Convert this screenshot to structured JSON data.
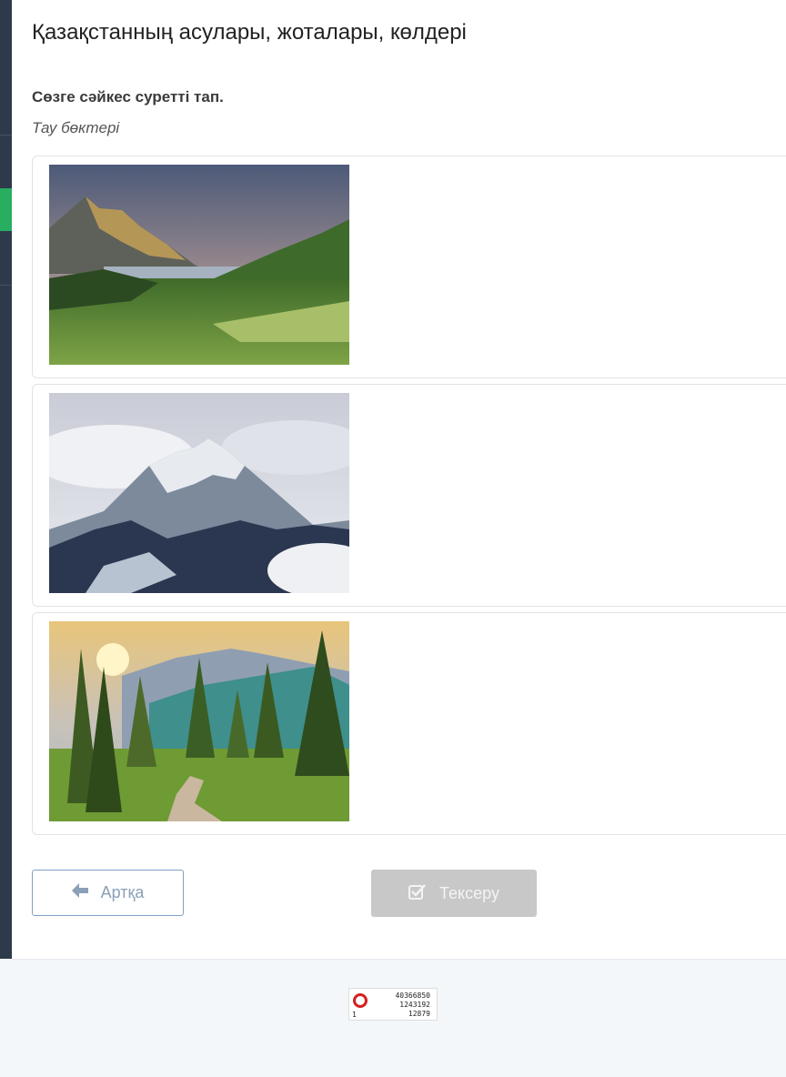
{
  "page": {
    "title": "Қазақстанның асулары, жоталары, көлдері",
    "question": "Сөзге сәйкес суретті тап.",
    "prompt": "Тау бөктері"
  },
  "options": [
    {
      "image": "mountain-foothills-valley-photo"
    },
    {
      "image": "snowy-mountain-peak-photo"
    },
    {
      "image": "forest-mountain-road-photo"
    }
  ],
  "buttons": {
    "back_label": "Артқа",
    "back_icon": "arrow-left-icon",
    "check_label": "Тексеру",
    "check_icon": "check-square-icon"
  },
  "counter": {
    "line1": "40366850",
    "line2": "1243192",
    "line3": "12879",
    "corner": "1"
  },
  "colors": {
    "sidebar": "#2d3a4a",
    "sidebar_active": "#27ae60",
    "check_disabled": "#c8c8c8",
    "back_border": "#7fa1c6"
  }
}
